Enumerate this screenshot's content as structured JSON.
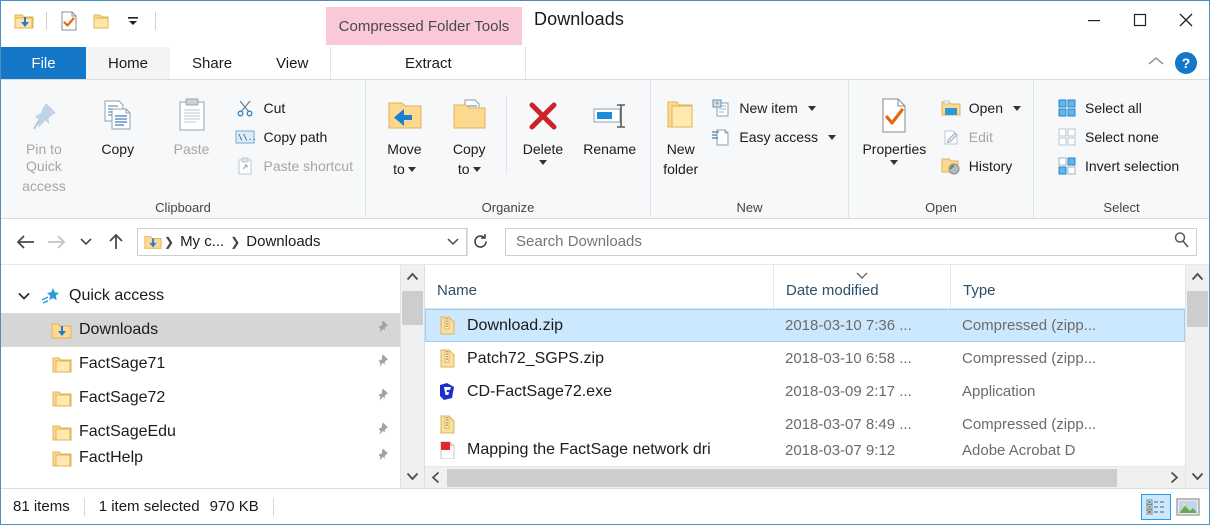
{
  "window": {
    "title": "Downloads",
    "contextual_tab": "Compressed Folder Tools",
    "minimize": "minimize-button",
    "maximize": "maximize-button",
    "close": "close-button"
  },
  "quick_access_toolbar": {
    "items": [
      {
        "name": "downloads-folder-icon",
        "label": "Downloads"
      },
      {
        "name": "properties-icon",
        "label": "Properties"
      },
      {
        "name": "new-folder-icon",
        "label": "New folder"
      },
      {
        "name": "customize-dropdown-icon",
        "label": "Customize Quick Access Toolbar"
      }
    ]
  },
  "tabs": [
    {
      "label": "File",
      "active": false
    },
    {
      "label": "Home",
      "active": true
    },
    {
      "label": "Share",
      "active": false
    },
    {
      "label": "View",
      "active": false
    },
    {
      "label": "Extract",
      "active": false
    }
  ],
  "ribbon_right": {
    "collapse": "collapse-ribbon",
    "help": "?"
  },
  "ribbon": {
    "groups": [
      {
        "label": "Clipboard",
        "big": [
          {
            "label": "Pin to Quick\naccess",
            "line1": "Pin to Quick",
            "line2": "access",
            "disabled": true
          },
          {
            "label": "Copy",
            "line1": "Copy",
            "line2": "",
            "disabled": false
          },
          {
            "label": "Paste",
            "line1": "Paste",
            "line2": "",
            "disabled": true
          }
        ],
        "small": [
          {
            "label": "Cut",
            "disabled": false
          },
          {
            "label": "Copy path",
            "disabled": false
          },
          {
            "label": "Paste shortcut",
            "disabled": true
          }
        ]
      },
      {
        "label": "Organize",
        "big": [
          {
            "line1": "Move",
            "line2": "to",
            "caret": true
          },
          {
            "line1": "Copy",
            "line2": "to",
            "caret": true
          },
          {
            "line1": "Delete",
            "line2": "",
            "caret_below": true
          },
          {
            "line1": "Rename",
            "line2": ""
          }
        ]
      },
      {
        "label": "New",
        "big": [
          {
            "line1": "New",
            "line2": "folder"
          }
        ],
        "small": [
          {
            "label": "New item",
            "caret": true
          },
          {
            "label": "Easy access",
            "caret": true
          }
        ]
      },
      {
        "label": "Open",
        "big": [
          {
            "line1": "Properties",
            "line2": "",
            "caret_below": true
          }
        ],
        "small": [
          {
            "label": "Open",
            "caret": true,
            "disabled": false
          },
          {
            "label": "Edit",
            "disabled": true
          },
          {
            "label": "History",
            "disabled": false
          }
        ]
      },
      {
        "label": "Select",
        "small": [
          {
            "label": "Select all"
          },
          {
            "label": "Select none"
          },
          {
            "label": "Invert selection"
          }
        ]
      }
    ]
  },
  "address_bar": {
    "back": "back-button",
    "forward": "forward-button",
    "recent": "recent-locations-button",
    "up": "up-button",
    "breadcrumbs": [
      "My c...",
      "Downloads"
    ],
    "dropdown": "address-dropdown",
    "refresh": "refresh-button"
  },
  "search": {
    "placeholder": "Search Downloads",
    "value": "",
    "icon": "search-icon"
  },
  "nav_pane": {
    "items": [
      {
        "label": "Quick access",
        "level": 0,
        "icon": "quick-access-star-icon",
        "selected": false,
        "pinned": false,
        "expanded": true
      },
      {
        "label": "Downloads",
        "level": 1,
        "icon": "downloads-folder-icon",
        "selected": true,
        "pinned": true
      },
      {
        "label": "FactSage71",
        "level": 1,
        "icon": "folder-icon",
        "selected": false,
        "pinned": true
      },
      {
        "label": "FactSage72",
        "level": 1,
        "icon": "folder-icon",
        "selected": false,
        "pinned": true
      },
      {
        "label": "FactSageEdu",
        "level": 1,
        "icon": "folder-icon",
        "selected": false,
        "pinned": true
      },
      {
        "label": "FactHelp",
        "level": 1,
        "icon": "folder-icon",
        "selected": false,
        "pinned": true,
        "clipped": true
      }
    ]
  },
  "file_list": {
    "columns": [
      {
        "label": "Name",
        "sorted": false
      },
      {
        "label": "Date modified",
        "sorted": true,
        "sort_dir": "asc"
      },
      {
        "label": "Type",
        "sorted": false
      }
    ],
    "rows": [
      {
        "name": "Download.zip",
        "date": "2018-03-10 7:36 ...",
        "type": "Compressed (zipp...",
        "icon": "zip-file-icon",
        "selected": true
      },
      {
        "name": "Patch72_SGPS.zip",
        "date": "2018-03-10 6:58 ...",
        "type": "Compressed (zipp...",
        "icon": "zip-file-icon",
        "selected": false
      },
      {
        "name": "CD-FactSage72.exe",
        "date": "2018-03-09 2:17 ...",
        "type": "Application",
        "icon": "application-icon",
        "selected": false
      },
      {
        "name": "",
        "date": "2018-03-07 8:49 ...",
        "type": "Compressed (zipp...",
        "icon": "zip-file-icon",
        "selected": false
      },
      {
        "name": "Mapping the FactSage network dri",
        "date": "2018-03-07 9:12",
        "type": "Adobe Acrobat D",
        "icon": "pdf-file-icon",
        "selected": false,
        "clipped": true
      }
    ]
  },
  "status_bar": {
    "item_count": "81 items",
    "selection": "1 item selected",
    "size": "970 KB",
    "view_details": "details-view-button",
    "view_large_icons": "large-icons-view-button"
  }
}
